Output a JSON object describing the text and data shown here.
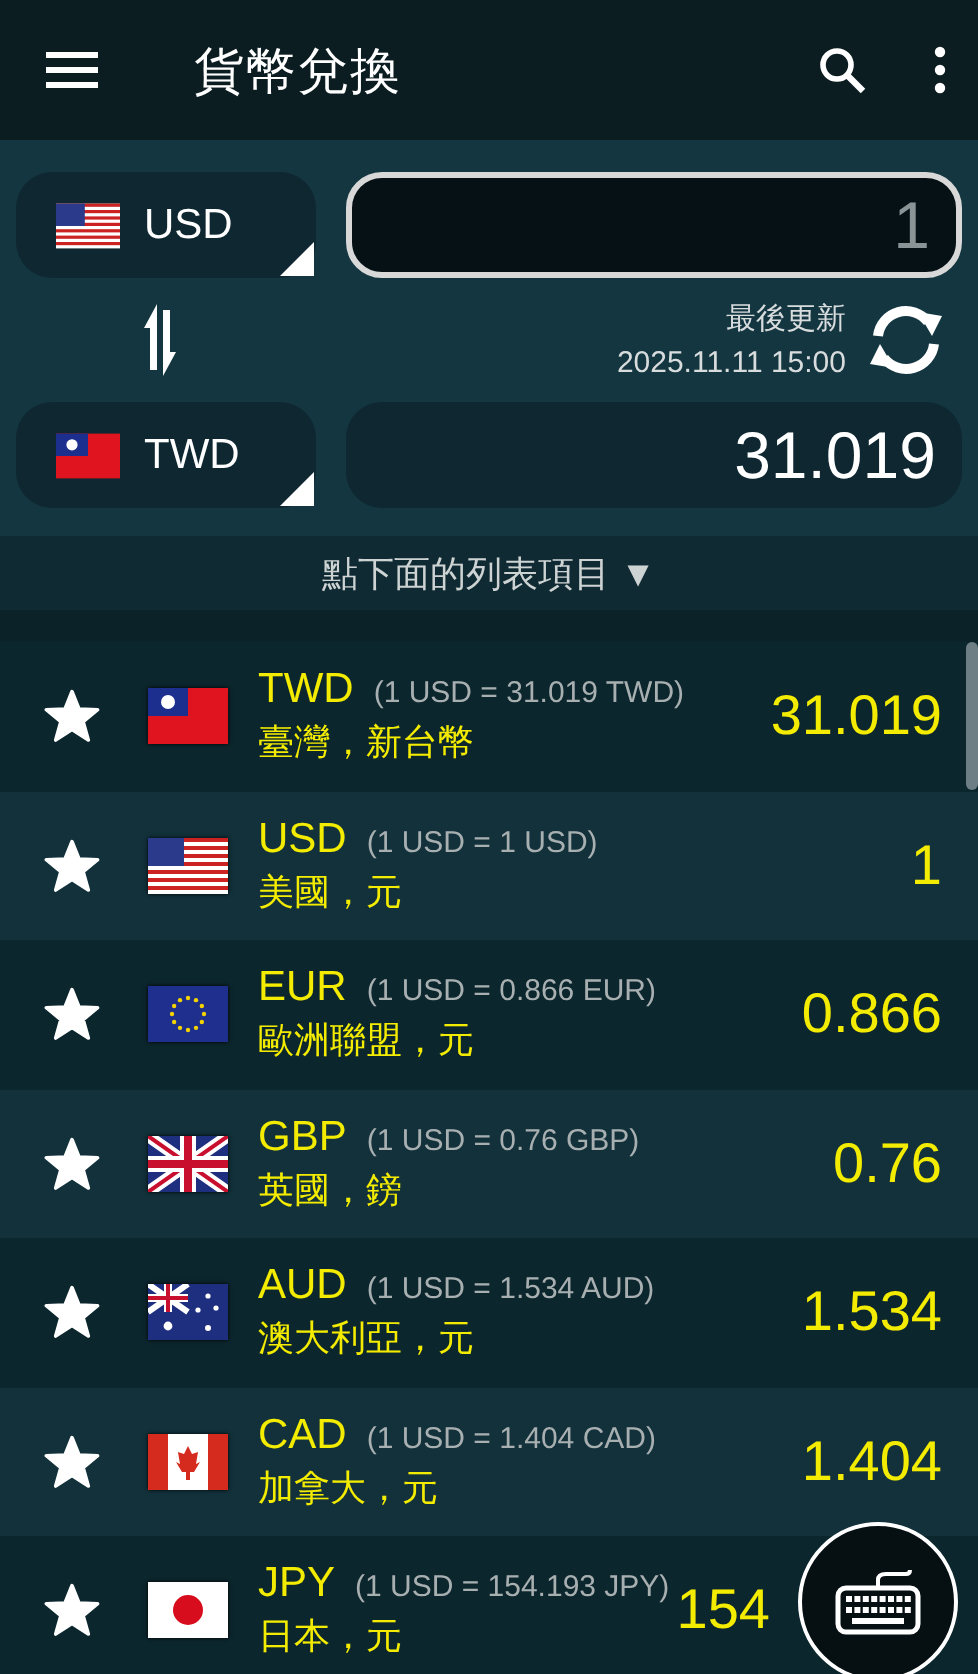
{
  "app_bar": {
    "title": "貨幣兌換"
  },
  "converter": {
    "from": {
      "code": "USD",
      "kind": "us",
      "amount": "1"
    },
    "to": {
      "code": "TWD",
      "kind": "tw",
      "amount": "31.019"
    },
    "update_label": "最後更新",
    "update_time": "2025.11.11 15:00"
  },
  "hint": "點下面的列表項目 ▼",
  "currencies": [
    {
      "code": "TWD",
      "kind": "tw",
      "rate": "(1 USD = 31.019 TWD)",
      "name": "臺灣，新台幣",
      "value": "31.019"
    },
    {
      "code": "USD",
      "kind": "us",
      "rate": "(1 USD = 1 USD)",
      "name": "美國，元",
      "value": "1"
    },
    {
      "code": "EUR",
      "kind": "eu",
      "rate": "(1 USD = 0.866 EUR)",
      "name": "歐洲聯盟，元",
      "value": "0.866"
    },
    {
      "code": "GBP",
      "kind": "gb",
      "rate": "(1 USD = 0.76 GBP)",
      "name": "英國，鎊",
      "value": "0.76"
    },
    {
      "code": "AUD",
      "kind": "au",
      "rate": "(1 USD = 1.534 AUD)",
      "name": "澳大利亞，元",
      "value": "1.534"
    },
    {
      "code": "CAD",
      "kind": "ca",
      "rate": "(1 USD = 1.404 CAD)",
      "name": "加拿大，元",
      "value": "1.404"
    },
    {
      "code": "JPY",
      "kind": "jp",
      "rate": "(1 USD = 154.193 JPY)",
      "name": "日本，元",
      "value": "154"
    }
  ]
}
